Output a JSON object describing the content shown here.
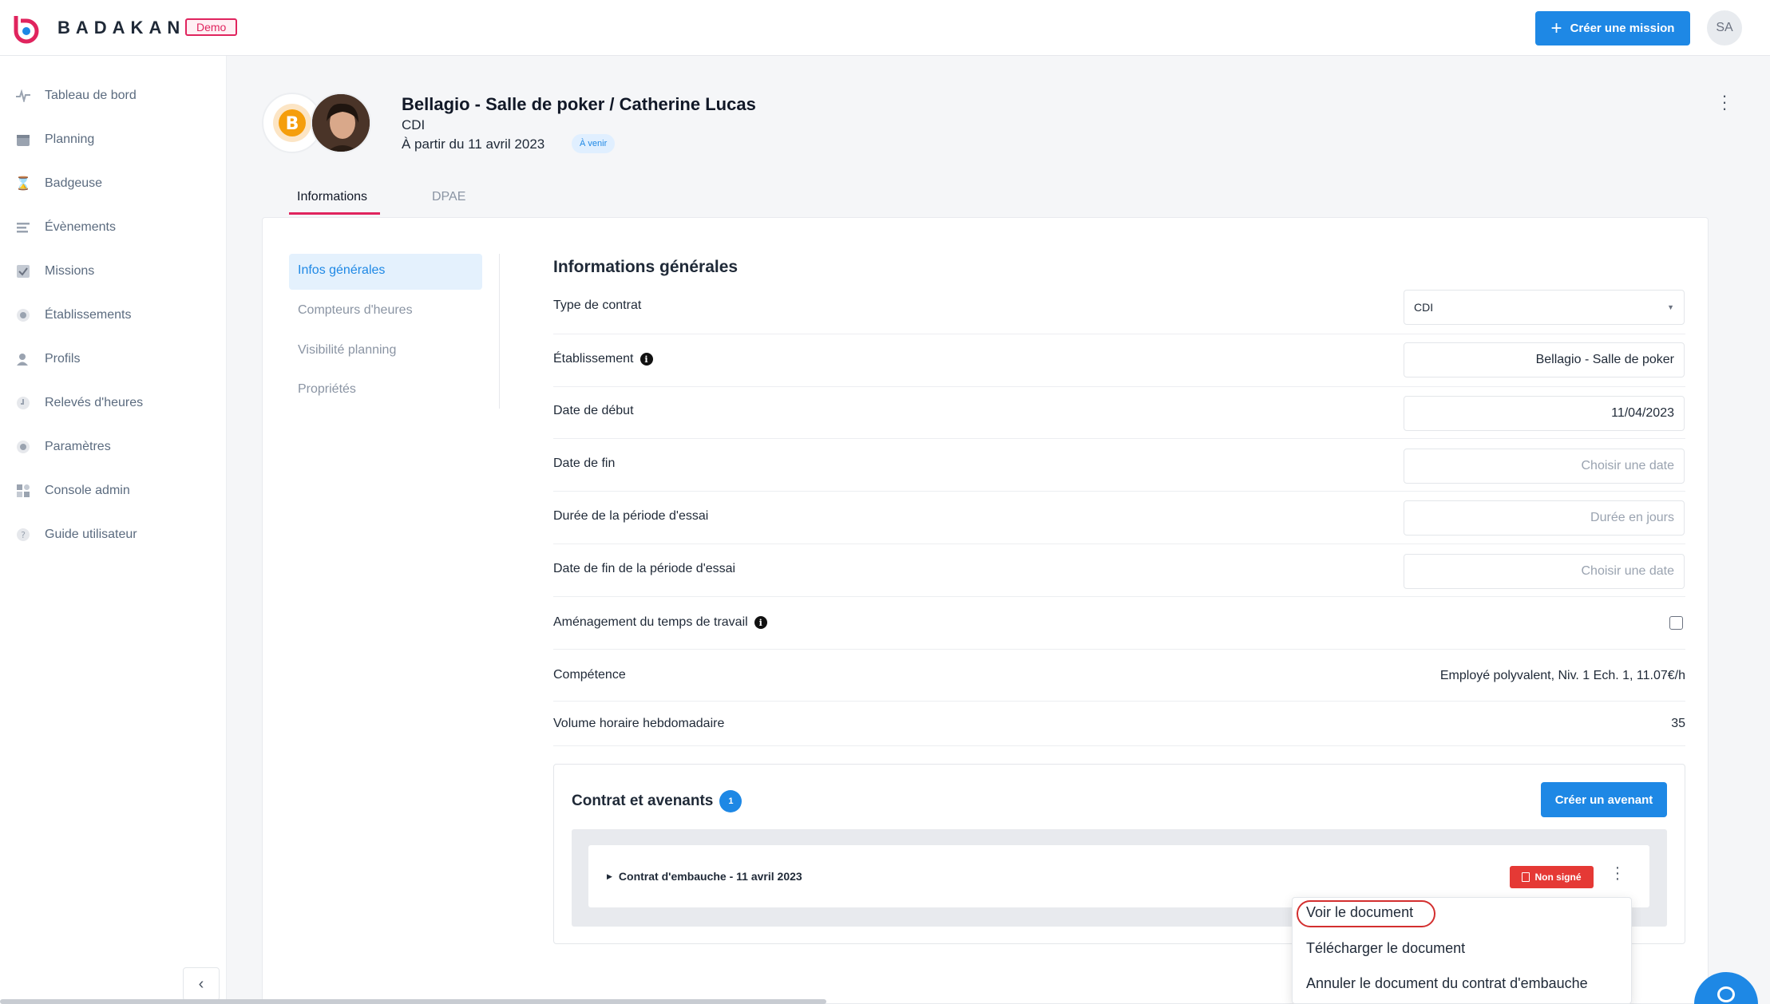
{
  "app": {
    "brand": "BADAKAN",
    "env_badge": "Demo",
    "create_mission_label": "Créer une mission",
    "user_initials": "SA",
    "accent_color": "#1e88e5",
    "brand_color": "#e0245e"
  },
  "sidebar": {
    "items": [
      {
        "label": "Tableau de bord",
        "icon": "pulse-icon"
      },
      {
        "label": "Planning",
        "icon": "calendar-icon"
      },
      {
        "label": "Badgeuse",
        "icon": "hourglass-icon"
      },
      {
        "label": "Évènements",
        "icon": "list-icon"
      },
      {
        "label": "Missions",
        "icon": "checkbox-icon"
      },
      {
        "label": "Établissements",
        "icon": "building-icon"
      },
      {
        "label": "Profils",
        "icon": "users-icon"
      },
      {
        "label": "Relevés d'heures",
        "icon": "clock-icon"
      },
      {
        "label": "Paramètres",
        "icon": "gear-icon"
      },
      {
        "label": "Console admin",
        "icon": "grid-icon"
      },
      {
        "label": "Guide utilisateur",
        "icon": "help-icon"
      }
    ],
    "collapse_icon": "chevron-left-icon"
  },
  "header": {
    "title": "Bellagio - Salle de poker / Catherine Lucas",
    "contract_type": "CDI",
    "since": "À partir du 11 avril 2023",
    "status_badge": "À venir"
  },
  "tabs": [
    {
      "label": "Informations",
      "active": true
    },
    {
      "label": "DPAE",
      "active": false
    }
  ],
  "subnav": [
    {
      "label": "Infos générales",
      "active": true
    },
    {
      "label": "Compteurs d'heures",
      "active": false
    },
    {
      "label": "Visibilité planning",
      "active": false
    },
    {
      "label": "Propriétés",
      "active": false
    }
  ],
  "section": {
    "title": "Informations générales",
    "rows": {
      "type_contrat": {
        "label": "Type de contrat",
        "value": "CDI"
      },
      "etablissement": {
        "label": "Établissement",
        "value": "Bellagio - Salle de poker"
      },
      "date_debut": {
        "label": "Date de début",
        "value": "11/04/2023"
      },
      "date_fin": {
        "label": "Date de fin",
        "placeholder": "Choisir une date"
      },
      "periode_essai": {
        "label": "Durée de la période d'essai",
        "placeholder": "Durée en jours"
      },
      "fin_essai": {
        "label": "Date de fin de la période d'essai",
        "placeholder": "Choisir une date"
      },
      "amenagement": {
        "label": "Aménagement du temps de travail",
        "checked": false
      },
      "competence": {
        "label": "Compétence",
        "value": "Employé polyvalent, Niv. 1 Ech. 1, 11.07€/h"
      },
      "volume": {
        "label": "Volume horaire hebdomadaire",
        "value": "35"
      }
    }
  },
  "contracts": {
    "title": "Contrat et avenants",
    "count": "1",
    "create_button": "Créer un avenant",
    "items": [
      {
        "name": "Contrat d'embauche - 11 avril 2023",
        "status": "Non signé"
      }
    ]
  },
  "dropdown": {
    "items": [
      "Voir le document",
      "Télécharger le document",
      "Annuler le document du contrat d'embauche"
    ]
  }
}
